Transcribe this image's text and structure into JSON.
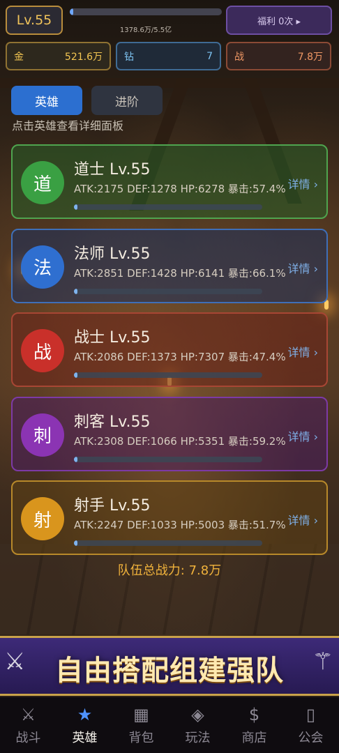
{
  "header": {
    "level": "Lv.55",
    "exp_fraction": 0.025,
    "exp_text": "1378.6万/5.5亿",
    "welfare": "福利 0次 ▸"
  },
  "resources": {
    "gold": {
      "label": "金",
      "value": "521.6万",
      "color": "#f3c652"
    },
    "diamond": {
      "label": "钻",
      "value": "7",
      "color": "#7ec4f3"
    },
    "power": {
      "label": "战",
      "value": "7.8万",
      "color": "#f09865"
    }
  },
  "tabs": [
    {
      "label": "英雄",
      "active": true
    },
    {
      "label": "进阶",
      "active": false
    }
  ],
  "hint": "点击英雄查看详细面板",
  "heroes": [
    {
      "glyph": "道",
      "name": "道士  Lv.55",
      "stats": "ATK:2175  DEF:1278  HP:6278  暴击:57.4%",
      "detail": "详情 ›",
      "progress": 0.02,
      "color": "#3aa043"
    },
    {
      "glyph": "法",
      "name": "法师  Lv.55",
      "stats": "ATK:2851  DEF:1428  HP:6141  暴击:66.1%",
      "detail": "详情 ›",
      "progress": 0.02,
      "color": "#2f6fd0"
    },
    {
      "glyph": "战",
      "name": "战士  Lv.55",
      "stats": "ATK:2086  DEF:1373  HP:7307  暴击:47.4%",
      "detail": "详情 ›",
      "progress": 0.02,
      "color": "#c9302a"
    },
    {
      "glyph": "刺",
      "name": "刺客  Lv.55",
      "stats": "ATK:2308  DEF:1066  HP:5351  暴击:59.2%",
      "detail": "详情 ›",
      "progress": 0.02,
      "color": "#8b34b3"
    },
    {
      "glyph": "射",
      "name": "射手  Lv.55",
      "stats": "ATK:2247  DEF:1033  HP:5003  暴击:51.7%",
      "detail": "详情 ›",
      "progress": 0.02,
      "color": "#d9951d"
    }
  ],
  "team_power": "队伍总战力: 7.8万",
  "banner": "自由搭配组建强队",
  "nav": [
    {
      "label": "战斗",
      "icon": "crossed-swords-icon",
      "glyph": "⚔",
      "active": false
    },
    {
      "label": "英雄",
      "icon": "star-icon",
      "glyph": "★",
      "active": true
    },
    {
      "label": "背包",
      "icon": "grid-icon",
      "glyph": "▦",
      "active": false
    },
    {
      "label": "玩法",
      "icon": "diamond-icon",
      "glyph": "◈",
      "active": false
    },
    {
      "label": "商店",
      "icon": "dollar-icon",
      "glyph": "$",
      "active": false
    },
    {
      "label": "公会",
      "icon": "banner-icon",
      "glyph": "▯",
      "active": false
    }
  ]
}
